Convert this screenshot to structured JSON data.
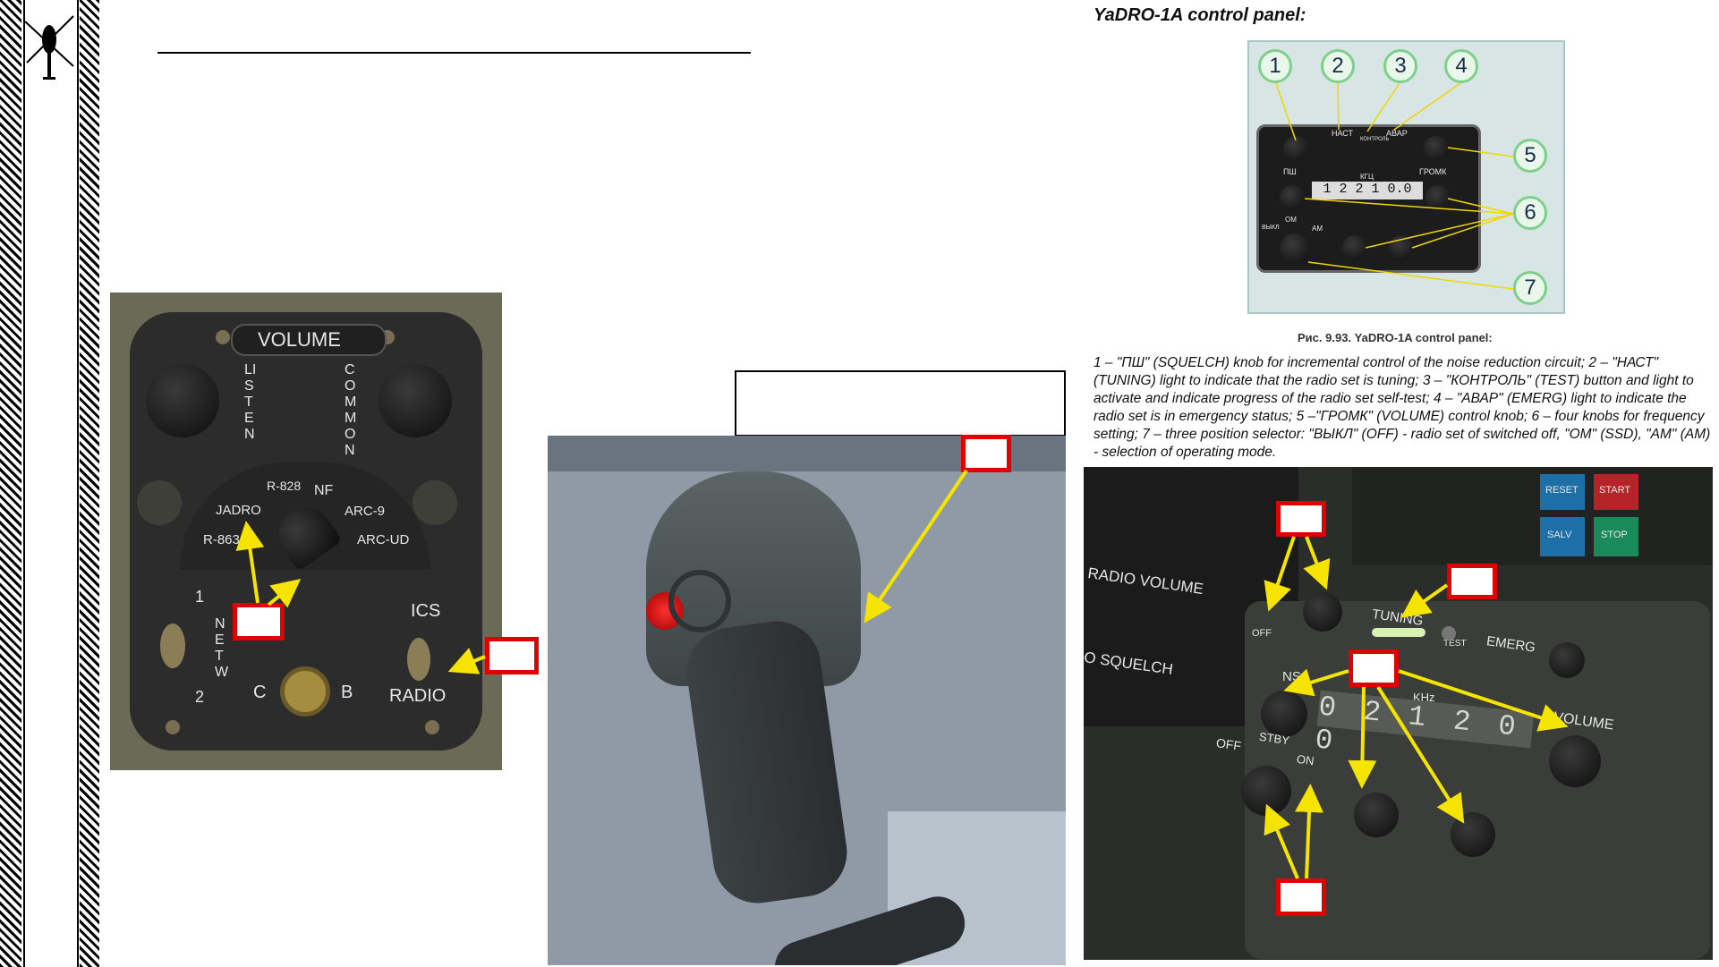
{
  "page": {
    "title": "YaDRO-1A control panel:"
  },
  "left_panel": {
    "labels": {
      "volume": "VOLUME",
      "listen": "LISTEN",
      "common": "COMMON",
      "r828": "R-828",
      "nf": "NF",
      "jadro": "JADRO",
      "arc9": "ARC-9",
      "r863": "R-863",
      "arcud": "ARC-UD",
      "ics": "ICS",
      "radio": "RADIO",
      "netw": "NETW",
      "one": "1",
      "two": "2",
      "c": "C",
      "b": "B"
    }
  },
  "reference_image": {
    "numbers": [
      "1",
      "2",
      "3",
      "4",
      "5",
      "6",
      "7"
    ],
    "labels": {
      "nast": "НАСТ",
      "kontrol": "КОНТРОЛЬ",
      "avar": "АВАР",
      "psh": "ПШ",
      "gromk": "ГРОМК",
      "kgts": "КГЦ",
      "om": "ОМ",
      "am": "АМ",
      "vykl": "ВЫКЛ"
    },
    "digits": "1 2 2 1 0.0",
    "caption": "Рис. 9.93. YaDRO-1A control panel:",
    "description": "1 – \"ПШ\" (SQUELCH) knob for incremental control of the noise reduction circuit; 2 – \"НАСТ\" (TUNING) light to indicate that the radio set is tuning; 3 – \"КОНТРОЛЬ\" (TEST) button and light to activate and indicate progress of the radio set self-test; 4 – \"АВАР\" (EMERG) light to indicate the radio set is in emergency status; 5 –\"ГРОМК\" (VOLUME) control knob; 6 – four knobs for frequency setting; 7 – three position selector: \"ВЫКЛ\" (OFF) - radio set of switched off, \"ОМ\" (SSD), \"АМ\" (AM) - selection of operating mode."
  },
  "cockpit_panel": {
    "labels": {
      "radio_volume": "RADIO VOLUME",
      "squelch": "O SQUELCH",
      "off_small": "OFF",
      "tuning": "TUNING",
      "test": "TEST",
      "emerg": "EMERG",
      "ns": "NS",
      "khz": "KHz",
      "volume": "VOLUME",
      "off": "OFF",
      "stby": "STBY",
      "on": "ON",
      "digits": "0 2 1 2 0 0",
      "reset": "RESET",
      "start": "START",
      "salv": "SALV",
      "stop": "STOP"
    }
  },
  "colors": {
    "arrow": "#f5e400",
    "callout_border": "#e00000"
  }
}
